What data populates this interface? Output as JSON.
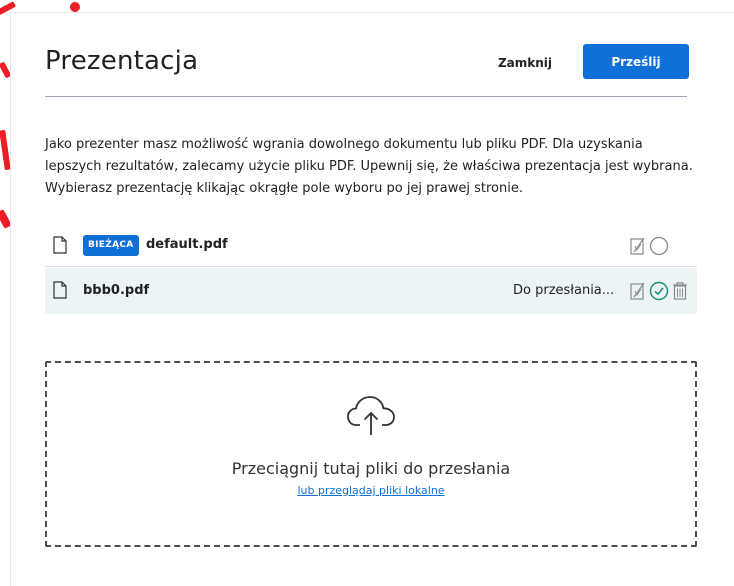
{
  "modal": {
    "title": "Prezentacja",
    "close_label": "Zamknij",
    "upload_label": "Prześlij",
    "intro": "Jako prezenter masz możliwość wgrania dowolnego dokumentu lub pliku PDF. Dla uzyskania lepszych rezultatów, zalecamy użycie pliku PDF. Upewnij się, że właściwa prezentacja jest wybrana. Wybierasz prezentację klikając okrągłe pole wyboru po jej prawej stronie."
  },
  "files": [
    {
      "badge": "BIEŻĄCA",
      "name": "default.pdf",
      "status": "",
      "selected": false
    },
    {
      "badge": "",
      "name": "bbb0.pdf",
      "status": "Do przesłania...",
      "selected": true
    }
  ],
  "dropzone": {
    "text": "Przeciągnij tutaj pliki do przesłania",
    "link": "lub przeglądaj pliki lokalne"
  },
  "colors": {
    "accent": "#0f70d7",
    "selected_check": "#1a8f7a",
    "selected_row_bg": "#edf4f6"
  },
  "icons": {
    "file": "file-icon",
    "download_toggle": "download-toggle-icon",
    "radio": "radio-icon",
    "check": "check-circle-icon",
    "delete": "trash-icon",
    "cloud_upload": "cloud-upload-icon"
  }
}
